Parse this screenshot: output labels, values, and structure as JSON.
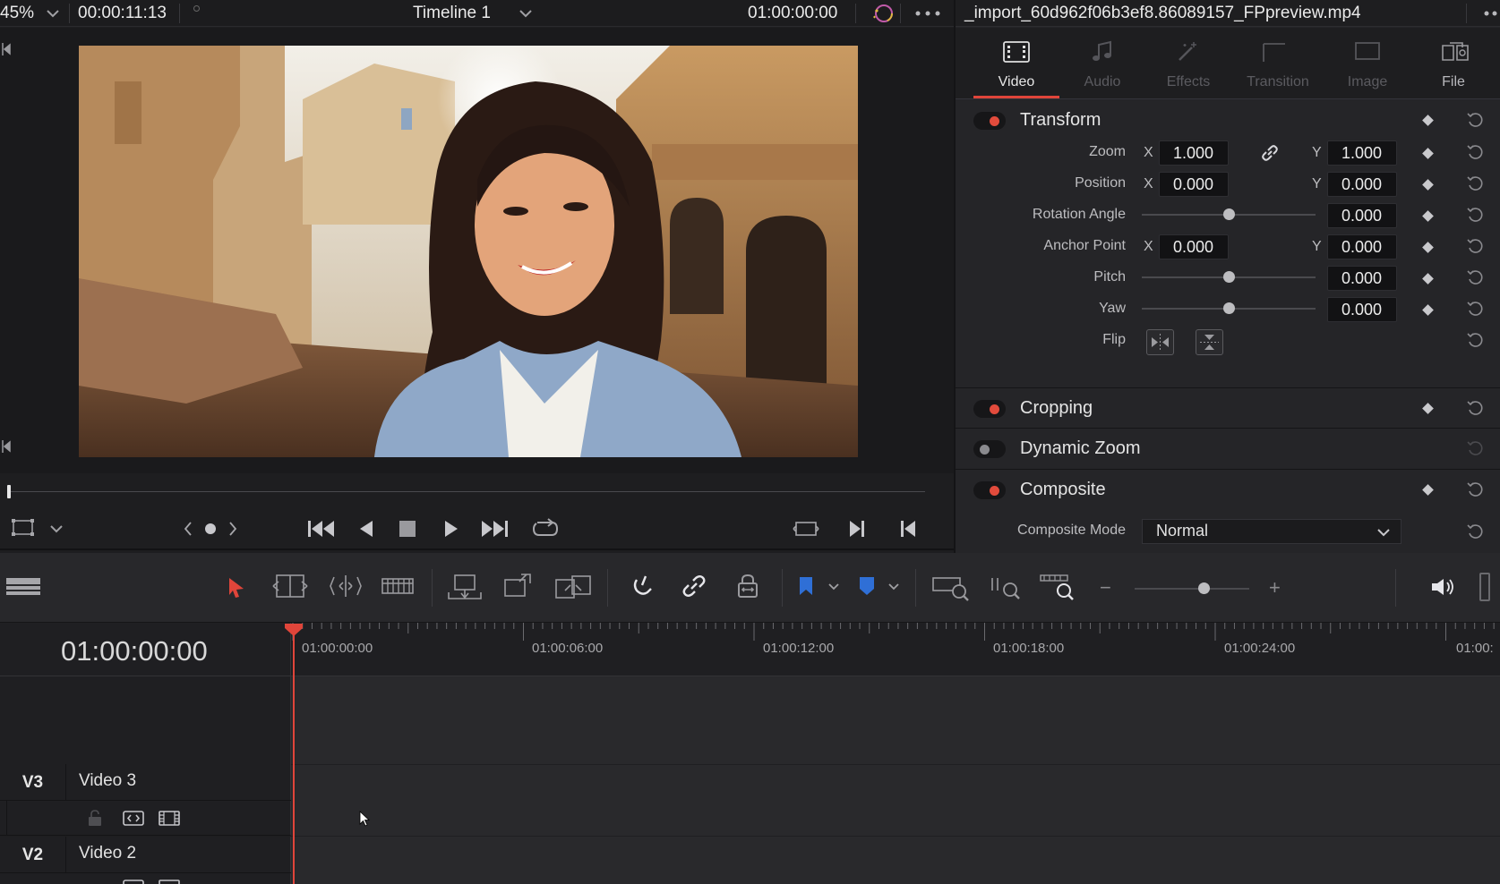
{
  "viewer": {
    "zoom": "45%",
    "source_timecode": "00:00:11:13",
    "timeline_name": "Timeline 1",
    "record_timecode": "01:00:00:00"
  },
  "inspector": {
    "clip_name": "_import_60d962f06b3ef8.86089157_FPpreview.mp4",
    "tabs": [
      {
        "label": "Video",
        "active": true,
        "icon": "film-frame-icon"
      },
      {
        "label": "Audio",
        "active": false,
        "icon": "music-note-icon"
      },
      {
        "label": "Effects",
        "active": false,
        "icon": "magic-wand-icon"
      },
      {
        "label": "Transition",
        "active": false,
        "icon": "transition-icon"
      },
      {
        "label": "Image",
        "active": false,
        "icon": "image-icon"
      },
      {
        "label": "File",
        "active": false,
        "icon": "file-icon"
      }
    ],
    "transform": {
      "title": "Transform",
      "zoom": {
        "label": "Zoom",
        "x": "1.000",
        "y": "1.000"
      },
      "position": {
        "label": "Position",
        "x": "0.000",
        "y": "0.000"
      },
      "rotation": {
        "label": "Rotation Angle",
        "value": "0.000",
        "slider": 0.5
      },
      "anchor": {
        "label": "Anchor Point",
        "x": "0.000",
        "y": "0.000"
      },
      "pitch": {
        "label": "Pitch",
        "value": "0.000",
        "slider": 0.5
      },
      "yaw": {
        "label": "Yaw",
        "value": "0.000",
        "slider": 0.5
      },
      "flip": {
        "label": "Flip"
      },
      "axis_x": "X",
      "axis_y": "Y"
    },
    "cropping": {
      "title": "Cropping"
    },
    "dynamic_zoom": {
      "title": "Dynamic Zoom"
    },
    "composite": {
      "title": "Composite",
      "mode_label": "Composite Mode",
      "mode_value": "Normal"
    }
  },
  "timeline": {
    "timecode": "01:00:00:00",
    "ruler": [
      "01:00:00:00",
      "01:00:06:00",
      "01:00:12:00",
      "01:00:18:00",
      "01:00:24:00",
      "01:00:"
    ],
    "tracks": [
      {
        "id": "V3",
        "name": "Video 3"
      },
      {
        "id": "V2",
        "name": "Video 2"
      }
    ],
    "zoom_slider": 0.6
  },
  "colors": {
    "accent": "#e0453a",
    "flag_blue": "#2f6fd6",
    "bg": "#1e1e20"
  }
}
